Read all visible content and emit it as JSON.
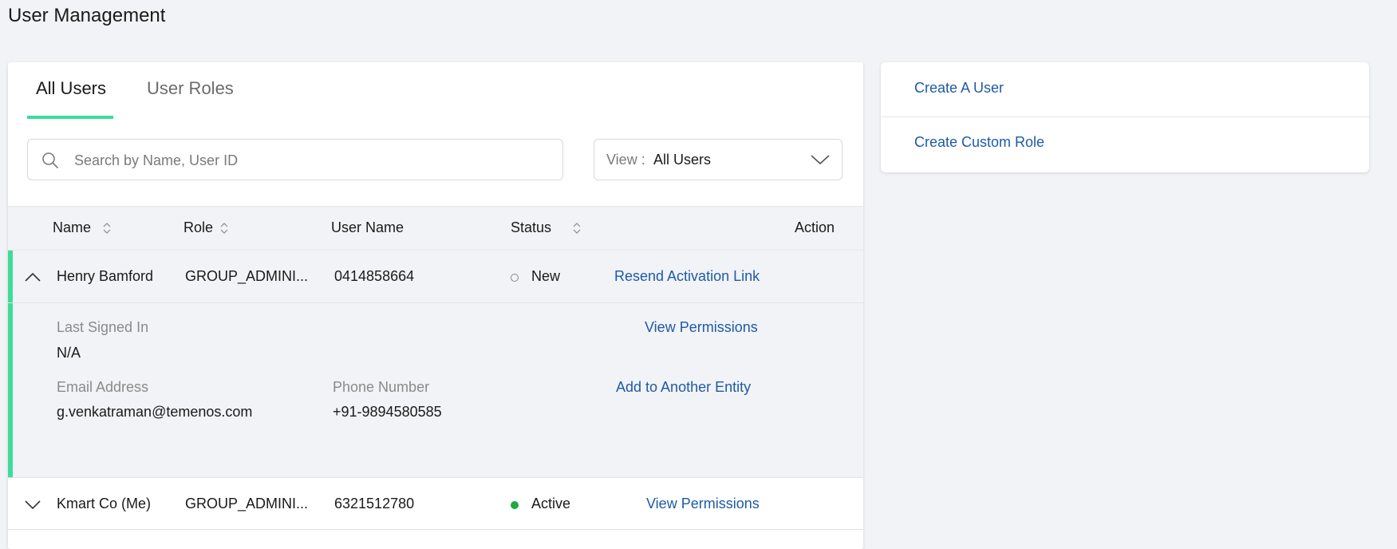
{
  "page": {
    "title": "User Management"
  },
  "tabs": [
    {
      "label": "All Users",
      "active": true
    },
    {
      "label": "User Roles",
      "active": false
    }
  ],
  "search": {
    "placeholder": "Search by Name, User ID",
    "value": ""
  },
  "view_filter": {
    "label": "View :",
    "value": "All Users"
  },
  "table": {
    "headers": {
      "name": "Name",
      "role": "Role",
      "username": "User Name",
      "status": "Status",
      "action": "Action"
    },
    "rows": [
      {
        "name": "Henry Bamford",
        "role": "GROUP_ADMINI...",
        "username": "0414858664",
        "status": "New",
        "action": "Resend Activation Link",
        "expanded": true,
        "details": {
          "last_signed_in_label": "Last Signed In",
          "last_signed_in_value": "N/A",
          "email_label": "Email Address",
          "email_value": "g.venkatraman@temenos.com",
          "phone_label": "Phone Number",
          "phone_value": "+91-9894580585",
          "view_permissions": "View Permissions",
          "add_entity": "Add to Another Entity"
        }
      },
      {
        "name": "Kmart Co (Me)",
        "role": "GROUP_ADMINI...",
        "username": "6321512780",
        "status": "Active",
        "action": "View Permissions",
        "expanded": false
      }
    ]
  },
  "side_panel": {
    "items": [
      "Create A User",
      "Create Custom Role"
    ]
  },
  "colors": {
    "accent": "#3ddc9a",
    "link": "#1f5aa6",
    "status_active": "#1faa3a",
    "background": "#f1f3f6"
  }
}
